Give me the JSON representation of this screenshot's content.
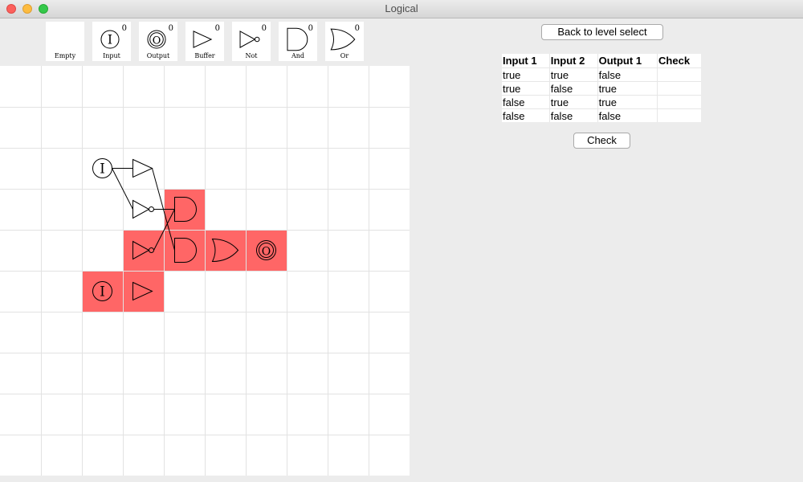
{
  "window": {
    "title": "Logical"
  },
  "palette": [
    {
      "id": "empty",
      "label": "Empty",
      "count": ""
    },
    {
      "id": "input",
      "label": "Input",
      "count": "0"
    },
    {
      "id": "output",
      "label": "Output",
      "count": "0"
    },
    {
      "id": "buffer",
      "label": "Buffer",
      "count": "0"
    },
    {
      "id": "not",
      "label": "Not",
      "count": "0"
    },
    {
      "id": "and",
      "label": "And",
      "count": "0"
    },
    {
      "id": "or",
      "label": "Or",
      "count": "0"
    }
  ],
  "controls": {
    "back_label": "Back to level select",
    "check_label": "Check"
  },
  "truth_table": {
    "headers": [
      "Input 1",
      "Input 2",
      "Output 1",
      "Check"
    ],
    "rows": [
      [
        "true",
        "true",
        "false",
        ""
      ],
      [
        "true",
        "false",
        "true",
        ""
      ],
      [
        "false",
        "true",
        "true",
        ""
      ],
      [
        "false",
        "false",
        "false",
        ""
      ]
    ]
  },
  "board": {
    "rows": 10,
    "cols": 10,
    "highlight_color": "#ff6666",
    "cells": [
      {
        "row": 2,
        "col": 2,
        "gate": "input",
        "highlighted": false
      },
      {
        "row": 2,
        "col": 3,
        "gate": "buffer",
        "highlighted": false
      },
      {
        "row": 3,
        "col": 3,
        "gate": "not",
        "highlighted": false
      },
      {
        "row": 3,
        "col": 4,
        "gate": "and",
        "highlighted": true
      },
      {
        "row": 4,
        "col": 3,
        "gate": "not",
        "highlighted": true
      },
      {
        "row": 4,
        "col": 4,
        "gate": "and",
        "highlighted": true
      },
      {
        "row": 4,
        "col": 5,
        "gate": "or",
        "highlighted": true
      },
      {
        "row": 4,
        "col": 6,
        "gate": "output",
        "highlighted": true
      },
      {
        "row": 5,
        "col": 2,
        "gate": "input",
        "highlighted": true
      },
      {
        "row": 5,
        "col": 3,
        "gate": "buffer",
        "highlighted": true
      }
    ],
    "wires": [
      {
        "from": [
          2,
          2
        ],
        "to": [
          2,
          3
        ]
      },
      {
        "from": [
          2,
          2
        ],
        "to": [
          3,
          3
        ]
      },
      {
        "from": [
          2,
          3
        ],
        "to": [
          4,
          4
        ]
      },
      {
        "from": [
          3,
          3
        ],
        "to": [
          3,
          4
        ]
      },
      {
        "from": [
          4,
          3
        ],
        "to": [
          3,
          4
        ]
      }
    ]
  }
}
